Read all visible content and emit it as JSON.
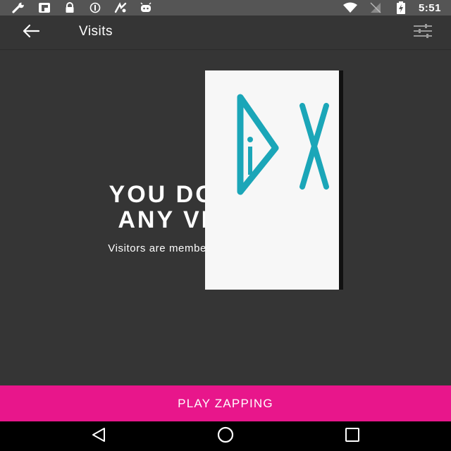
{
  "status_bar": {
    "time": "5:51",
    "icons_left": [
      "wrench-icon",
      "flipboard-icon",
      "lock-icon",
      "sync-icon",
      "app-icon",
      "android-icon"
    ],
    "icons_right": [
      "wifi-icon",
      "signal-icon",
      "battery-charging-icon"
    ]
  },
  "app_bar": {
    "title": "Visits",
    "back_icon": "arrow-left-icon",
    "filter_icon": "sliders-icon"
  },
  "empty_state": {
    "title_line_1": "YOU DON'T HAVE",
    "title_line_2": "ANY VISITS YET",
    "subtitle": "Visitors are members who viewed your profile."
  },
  "logo": {
    "text": "DX",
    "color": "#1ba6b8"
  },
  "play_button": {
    "label": "PLAY ZAPPING",
    "color": "#e8168b"
  },
  "nav_bar": {
    "back": "triangle-back-icon",
    "home": "circle-home-icon",
    "recents": "square-recents-icon"
  }
}
